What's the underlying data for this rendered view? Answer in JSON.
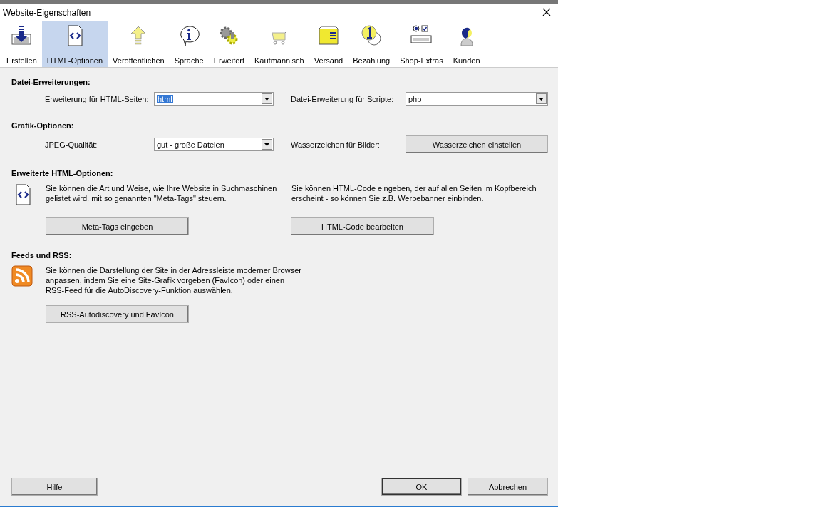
{
  "window": {
    "title": "Website-Eigenschaften"
  },
  "tabs": [
    {
      "label": "Erstellen",
      "kind": "download",
      "selected": false
    },
    {
      "label": "HTML-Optionen",
      "kind": "code",
      "selected": true
    },
    {
      "label": "Veröffentlichen",
      "kind": "upload",
      "selected": false
    },
    {
      "label": "Sprache",
      "kind": "info",
      "selected": false
    },
    {
      "label": "Erweitert",
      "kind": "gears",
      "selected": false
    },
    {
      "label": "Kaufmännisch",
      "kind": "cart",
      "selected": false
    },
    {
      "label": "Versand",
      "kind": "envelope",
      "selected": false
    },
    {
      "label": "Bezahlung",
      "kind": "coins",
      "selected": false
    },
    {
      "label": "Shop-Extras",
      "kind": "controls",
      "selected": false
    },
    {
      "label": "Kunden",
      "kind": "person",
      "selected": false
    }
  ],
  "file_extensions": {
    "heading": "Datei-Erweiterungen:",
    "html_label": "Erweiterung für HTML-Seiten:",
    "html_value": "html",
    "html_value_highlighted": true,
    "script_label": "Datei-Erweiterung für Scripte:",
    "script_value": "php",
    "script_value_highlighted": false
  },
  "graphics": {
    "heading": "Grafik-Optionen:",
    "jpeg_label": "JPEG-Qualität:",
    "jpeg_value": "gut - große Dateien",
    "watermark_label": "Wasserzeichen für Bilder:",
    "watermark_button": "Wasserzeichen einstellen"
  },
  "advanced_html": {
    "heading": "Erweiterte HTML-Optionen:",
    "meta_text": "Sie können die Art und Weise, wie Ihre Website in Suchmaschinen gelistet wird, mit so genannten \"Meta-Tags\" steuern.",
    "html_text": "Sie können HTML-Code eingeben, der auf allen Seiten im Kopfbereich erscheint - so können Sie z.B. Werbebanner einbinden.",
    "meta_button": "Meta-Tags eingeben",
    "html_button": "HTML-Code bearbeiten"
  },
  "feeds": {
    "heading": "Feeds und RSS:",
    "text": "Sie können die Darstellung der Site in der Adressleiste moderner Browser anpassen, indem Sie eine Site-Grafik vorgeben (FavIcon) oder einen RSS-Feed für die AutoDiscovery-Funktion auswählen.",
    "button": "RSS-Autodiscovery und FavIcon"
  },
  "footer": {
    "help_button": "Hilfe",
    "ok_button": "OK",
    "cancel_button": "Abbrechen"
  }
}
